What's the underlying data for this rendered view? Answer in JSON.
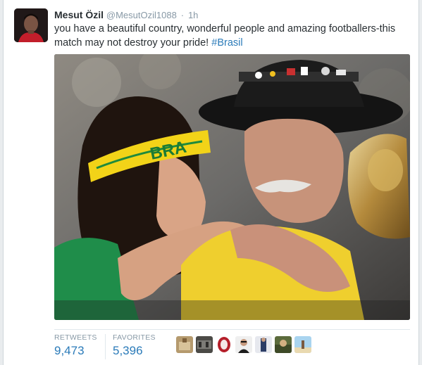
{
  "tweet": {
    "display_name": "Mesut Özil",
    "handle": "@MesutOzil1088",
    "separator": "·",
    "time": "1h",
    "text": "you have a beautiful country, wonderful people and amazing footballers-this match may not destroy your pride! ",
    "hashtag": "#Brasil"
  },
  "photo": {
    "headband_text": "BRA"
  },
  "stats": {
    "retweets_label": "RETWEETS",
    "retweets_value": "9,473",
    "favorites_label": "FAVORITES",
    "favorites_value": "5,396"
  },
  "colors": {
    "link": "#2b7bb9",
    "text": "#292f33",
    "muted": "#8899a6"
  }
}
